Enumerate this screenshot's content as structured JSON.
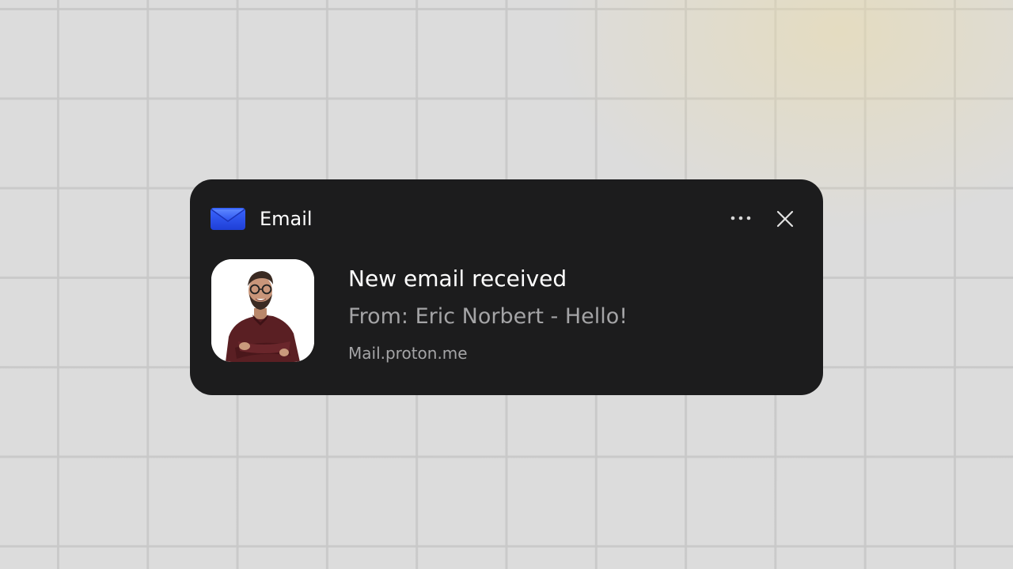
{
  "notification": {
    "app_name": "Email",
    "app_icon": "envelope-icon",
    "more_icon": "more-horizontal-icon",
    "close_icon": "close-icon",
    "title": "New email received",
    "subtitle": "From: Eric Norbert - Hello!",
    "source": "Mail.proton.me",
    "avatar": "sender-avatar"
  },
  "colors": {
    "card_background": "#1c1c1d",
    "primary_text": "#ffffff",
    "secondary_text": "#a4a4a6",
    "accent_blue": "#2f5bff",
    "page_background": "#dcdcdc"
  }
}
